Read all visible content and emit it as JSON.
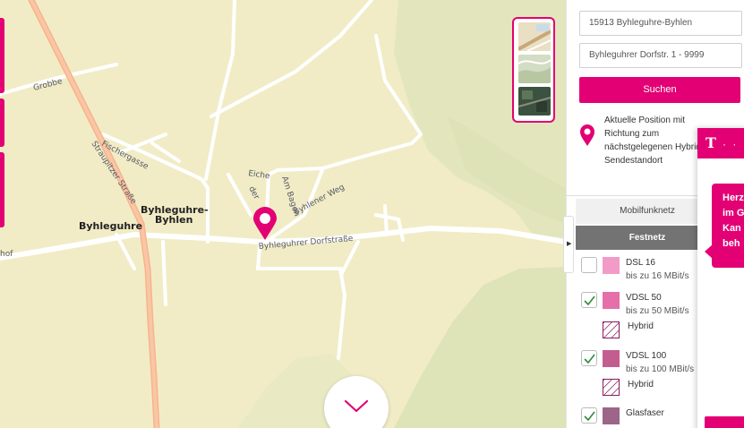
{
  "map": {
    "places": {
      "byhleguhre": "Byhleguhre",
      "byhleguhre_byhlen_line1": "Byhleguhre-",
      "byhleguhre_byhlen_line2": "Byhlen",
      "hof": "hof"
    },
    "streets": {
      "grobbe": "Grobbe",
      "fischergasse": "Fischergasse",
      "straupitzer": "Straupitzer Straße",
      "eiche": "Eiche",
      "der": "der",
      "am_bagen": "Am Bagen",
      "byhlener_weg": "Byhlener Weg",
      "dorfstrasse": "Byhleguhrer Dorfstraße"
    },
    "layers": [
      "map-layer",
      "terrain-layer",
      "satellite-layer"
    ],
    "colors": {
      "land": "#f1ecc6",
      "forest": "#e2e5bc",
      "road": "#ffffff",
      "main_road": "#f5b08a",
      "accent": "#e20074"
    }
  },
  "panel": {
    "address_value": "15913 Byhleguhre-Byhlen",
    "street_value": "Byhleguhrer Dorfstr. 1 - 9999",
    "search_label": "Suchen",
    "position_text": "Aktuelle Position mit Richtung zum nächstgelegenen Hybrid-Sendestandort",
    "tabs": {
      "mobil": "Mobilfunknetz",
      "fest": "Festnetz"
    },
    "legend": [
      {
        "title": "DSL 16",
        "subtitle": "bis zu 16 MBit/s",
        "checked": false,
        "color": "#f29bc9"
      },
      {
        "title": "VDSL 50",
        "subtitle": "bis zu 50 MBit/s",
        "checked": true,
        "color": "#e56fa9",
        "hybrid": "Hybrid"
      },
      {
        "title": "VDSL 100",
        "subtitle": "bis zu 100 MBit/s",
        "checked": true,
        "color": "#c45d8f",
        "hybrid": "Hybrid"
      },
      {
        "title": "Glasfaser",
        "subtitle": "",
        "checked": true,
        "color": "#9c6688"
      }
    ]
  },
  "chat": {
    "logo": "T",
    "dots": "· ·",
    "bubble_lines": [
      "Herz",
      "im G",
      "Kan",
      "beh"
    ]
  }
}
